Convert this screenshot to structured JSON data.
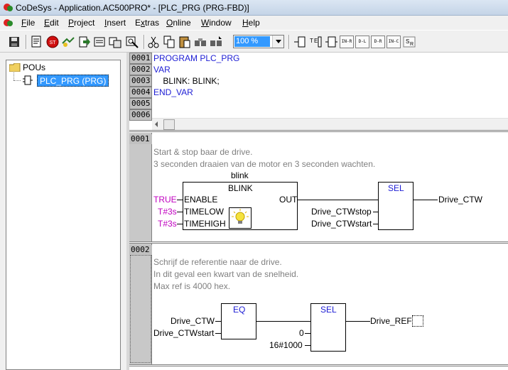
{
  "window": {
    "title": "CoDeSys - Application.AC500PRO* - [PLC_PRG (PRG-FBD)]"
  },
  "menu": {
    "items": [
      {
        "label": "File",
        "ul": "F"
      },
      {
        "label": "Edit",
        "ul": "E"
      },
      {
        "label": "Project",
        "ul": "P"
      },
      {
        "label": "Insert",
        "ul": "I"
      },
      {
        "label": "Extras",
        "ul": "x"
      },
      {
        "label": "Online",
        "ul": "O"
      },
      {
        "label": "Window",
        "ul": "W"
      },
      {
        "label": "Help",
        "ul": "H"
      }
    ]
  },
  "toolbar": {
    "zoom_value": "100 %",
    "small_buttons": [
      "IN-R",
      "D-L",
      "D-R",
      "IN-C",
      "R"
    ]
  },
  "tree": {
    "root_label": "POUs",
    "selected_label": "PLC_PRG (PRG)"
  },
  "declaration": {
    "line_numbers": [
      "0001",
      "0002",
      "0003",
      "0004",
      "0005",
      "0006"
    ],
    "lines": [
      "PROGRAM PLC_PRG",
      "VAR",
      "    BLINK: BLINK;",
      "END_VAR",
      "",
      ""
    ]
  },
  "network1": {
    "number": "0001",
    "comments": [
      "Start & stop baar de drive.",
      "3 seconden draaien van de motor en 3 seconden wachten."
    ],
    "instance_name": "blink",
    "block_type": "BLINK",
    "inputs": [
      {
        "value": "TRUE",
        "pin": "ENABLE"
      },
      {
        "value": "T#3s",
        "pin": "TIMELOW"
      },
      {
        "value": "T#3s",
        "pin": "TIMEHIGH"
      }
    ],
    "output_pin": "OUT",
    "sel_title": "SEL",
    "sel_inputs": [
      "Drive_CTWstop",
      "Drive_CTWstart"
    ],
    "sel_output": "Drive_CTW"
  },
  "network2": {
    "number": "0002",
    "comments": [
      "Schrijf de referentie naar de drive.",
      "In dit geval een kwart van de snelheid.",
      "Max ref is 4000 hex."
    ],
    "eq_title": "EQ",
    "eq_inputs": [
      "Drive_CTW",
      "Drive_CTWstart"
    ],
    "sel_title": "SEL",
    "sel_inputs": [
      "0",
      "16#1000"
    ],
    "sel_output": "Drive_REF"
  }
}
